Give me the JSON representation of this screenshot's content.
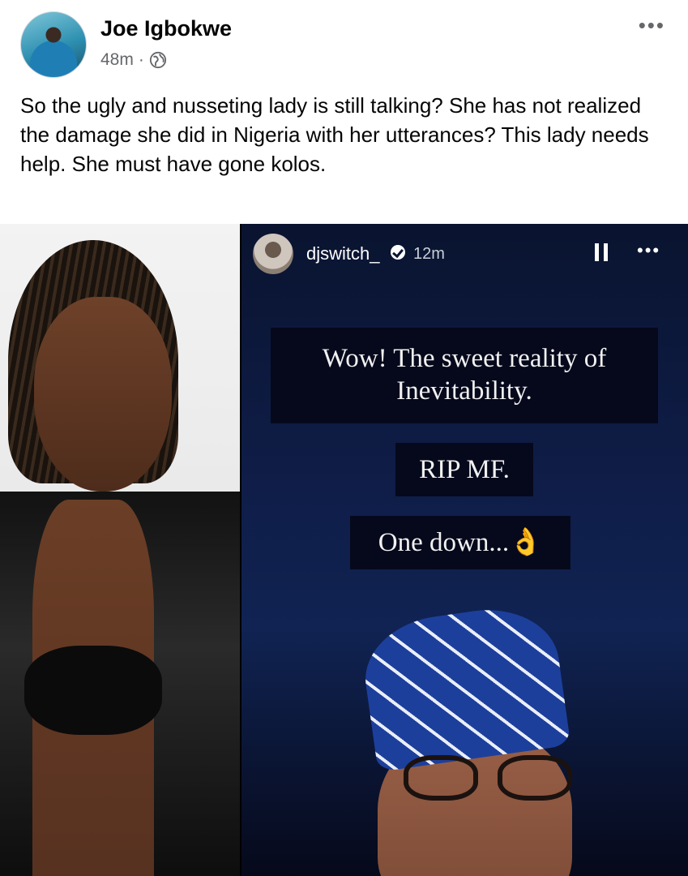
{
  "post": {
    "author": "Joe Igbokwe",
    "time": "48m",
    "separator": "·",
    "privacy_icon": "globe-icon",
    "more_icon": "more-options-icon",
    "more_label": "•••",
    "text": "So the ugly and nusseting lady is still talking? She has not realized the damage she did in Nigeria with her utterances? This lady needs help. She must have gone kolos."
  },
  "story": {
    "username": "djswitch_",
    "verified_icon": "verified-badge-icon",
    "time": "12m",
    "pause_icon": "pause-icon",
    "more_label": "•••",
    "captions": [
      "Wow! The sweet reality of Inevitability.",
      "RIP MF.",
      "One down...👌"
    ]
  }
}
